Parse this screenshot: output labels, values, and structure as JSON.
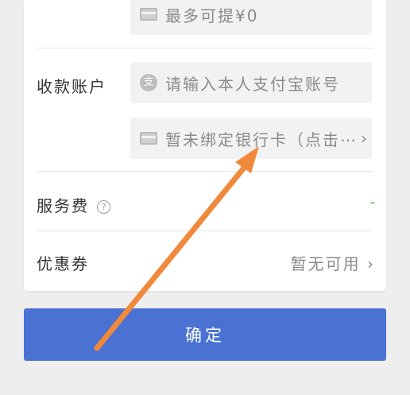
{
  "withdraw": {
    "max_hint": "最多可提¥0"
  },
  "account": {
    "label": "收款账户",
    "alipay_placeholder": "请输入本人支付宝账号",
    "bank_card_hint": "暂未绑定银行卡（点击⋯"
  },
  "service_fee": {
    "label": "服务费",
    "help": "?",
    "value": "-"
  },
  "coupon": {
    "label": "优惠券",
    "value": "暂无可用"
  },
  "confirm_label": "确定",
  "icons": [
    "card-icon",
    "alipay-icon",
    "help-icon",
    "chevron-right-icon"
  ],
  "colors": {
    "primary": "#4a72d3",
    "annotation_arrow": "#f0893c",
    "fee": "#4caf50"
  }
}
